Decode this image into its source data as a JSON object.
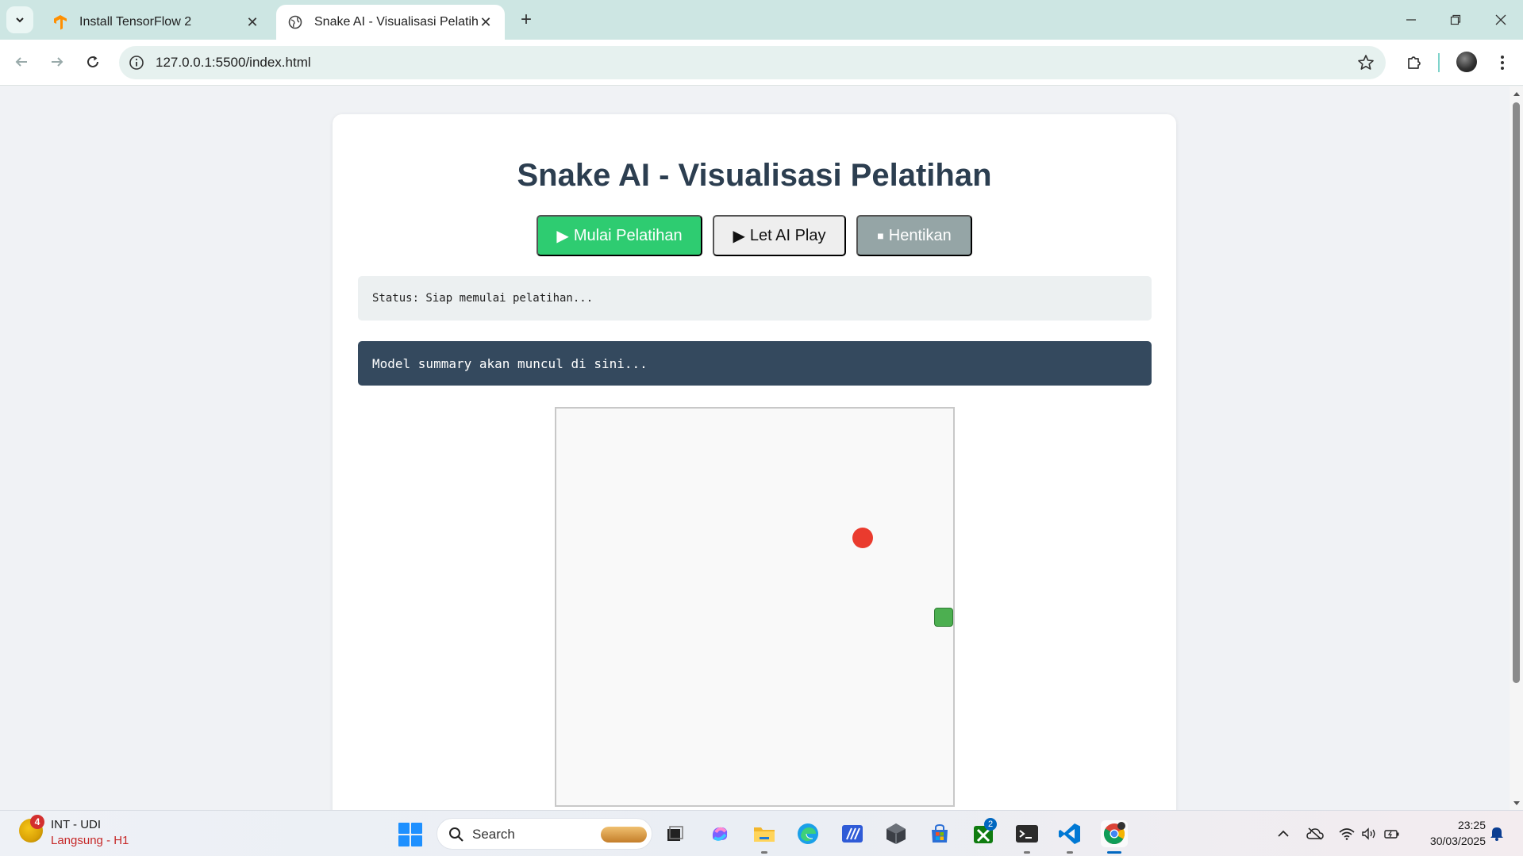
{
  "browser": {
    "tabs": [
      {
        "label": "Install TensorFlow 2",
        "icon": "tensorflow-icon",
        "active": false
      },
      {
        "label": "Snake AI - Visualisasi Pelatihan",
        "icon": "globe-icon",
        "active": true
      }
    ],
    "url": "127.0.0.1:5500/index.html"
  },
  "page": {
    "title": "Snake AI - Visualisasi Pelatihan",
    "buttons": {
      "start_icon": "▶",
      "start": "Mulai Pelatihan",
      "play_icon": "▶",
      "play": "Let AI Play",
      "stop_icon": "■",
      "stop": "Hentikan"
    },
    "status": "Status: Siap memulai pelatihan...",
    "model_summary": "Model summary akan muncul di sini...",
    "game": {
      "food_color": "#ea3b2e",
      "snake_color": "#4caf50"
    }
  },
  "taskbar": {
    "news_title": "INT - UDI",
    "news_subtitle": "Langsung - H1",
    "news_badge": "4",
    "search_placeholder": "Search",
    "xbox_badge": "2",
    "time": "23:25",
    "date": "30/03/2025"
  },
  "colors": {
    "accent_green": "#2ecc71",
    "stop_gray": "#95a5a6",
    "title_text": "#2c3e50",
    "summary_bg": "#34495e"
  }
}
